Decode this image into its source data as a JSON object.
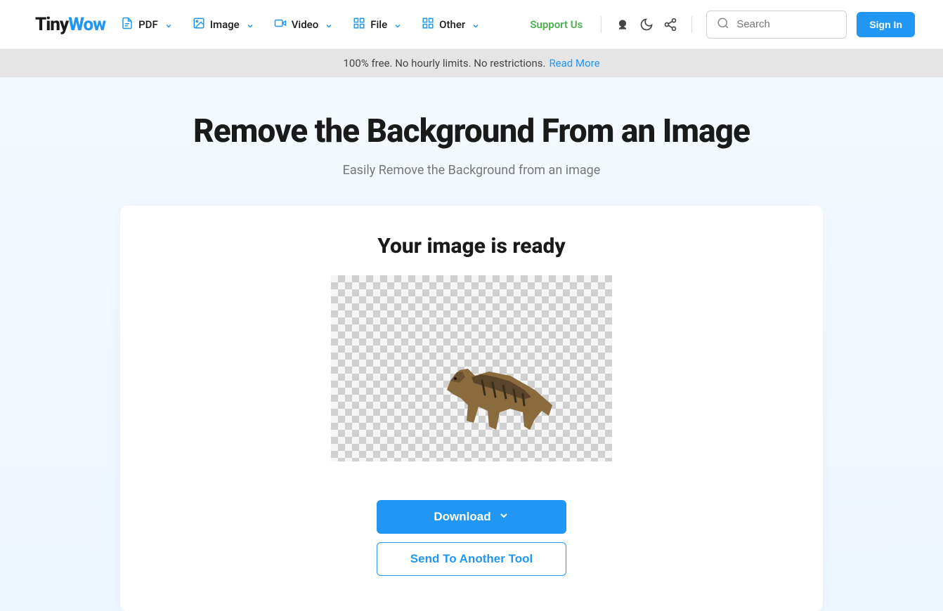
{
  "logo": {
    "part1": "Tiny",
    "part2": "Wow"
  },
  "nav": {
    "pdf": "PDF",
    "image": "Image",
    "video": "Video",
    "file": "File",
    "other": "Other"
  },
  "header": {
    "support": "Support Us",
    "search_placeholder": "Search",
    "sign_in": "Sign In"
  },
  "banner": {
    "text": "100% free. No hourly limits. No restrictions.",
    "link": "Read More"
  },
  "page": {
    "title": "Remove the Background From an Image",
    "subtitle": "Easily Remove the Background from an image"
  },
  "card": {
    "title": "Your image is ready",
    "download": "Download",
    "send": "Send To Another Tool"
  }
}
